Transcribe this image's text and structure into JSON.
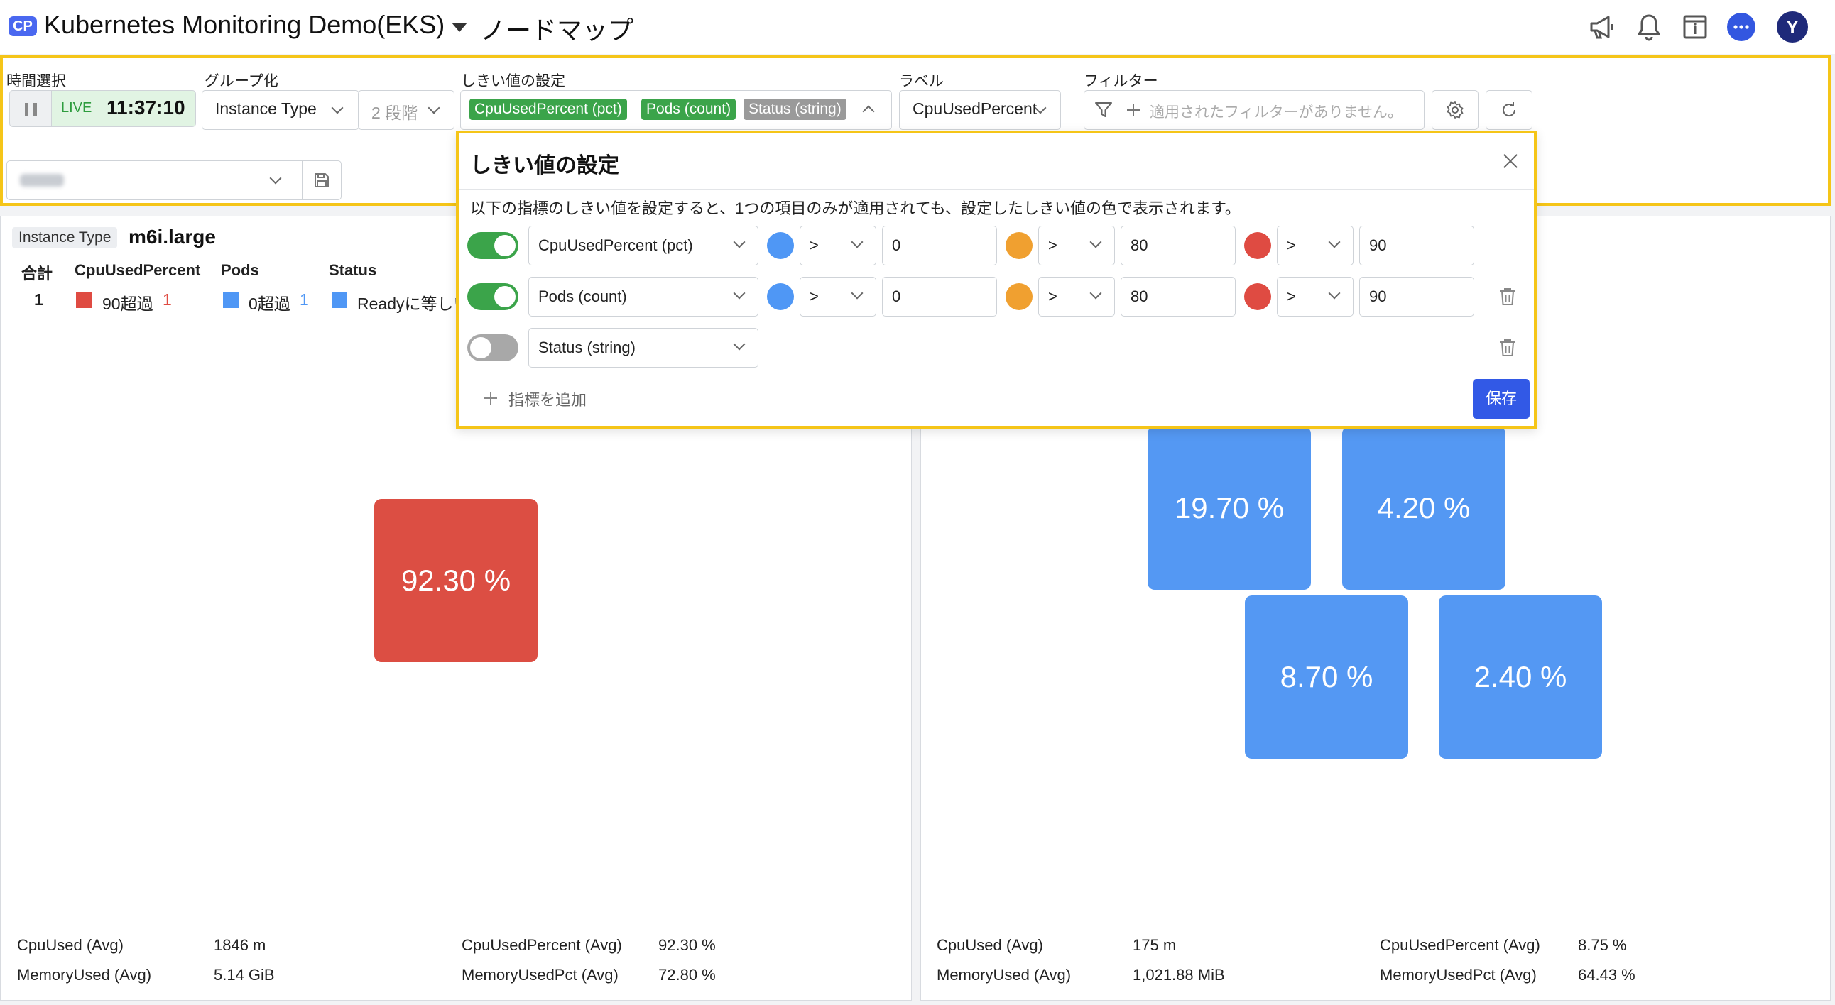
{
  "header": {
    "badge": "CP",
    "project": "Kubernetes Monitoring Demo(EKS)",
    "page_title": "ノードマップ"
  },
  "toolbar": {
    "time_label": "時間選択",
    "live_label": "LIVE",
    "live_time": "11:37:10",
    "group_label": "グループ化",
    "group_value": "Instance Type",
    "group_depth": "2 段階",
    "threshold_label": "しきい値の設定",
    "threshold_chips": [
      {
        "text": "CpuUsedPercent (pct)",
        "color": "#3ba44a"
      },
      {
        "text": "Pods (count)",
        "color": "#3ba44a"
      },
      {
        "text": "Status (string)",
        "color": "#9a9a9a"
      }
    ],
    "label_label": "ラベル",
    "label_value": "CpuUsedPercent",
    "filter_label": "フィルター",
    "filter_placeholder": "適用されたフィルターがありません。"
  },
  "popup": {
    "title": "しきい値の設定",
    "description": "以下の指標のしきい値を設定すると、1つの項目のみが適用されても、設定したしきい値の色で表示されます。",
    "rows": [
      {
        "enabled": true,
        "metric": "CpuUsedPercent (pct)",
        "op1": ">",
        "val1": "0",
        "op2": ">",
        "val2": "80",
        "op3": ">",
        "val3": "90"
      },
      {
        "enabled": true,
        "metric": "Pods (count)",
        "op1": ">",
        "val1": "0",
        "op2": ">",
        "val2": "80",
        "op3": ">",
        "val3": "90"
      },
      {
        "enabled": false,
        "metric": "Status (string)"
      }
    ],
    "add_metric": "指標を追加",
    "save": "保存"
  },
  "colors": {
    "blue": "#4f97f5",
    "orange": "#f0a030",
    "red": "#df4b42",
    "tile_red": "#dc4e43",
    "tile_blue": "#5498f3"
  },
  "left_panel": {
    "badge": "Instance Type",
    "group": "m6i.large",
    "legend_headers": {
      "total": "合計",
      "cpu": "CpuUsedPercent",
      "pods": "Pods",
      "status": "Status"
    },
    "legend_values": {
      "total": "1",
      "cpu_text": "90超過",
      "cpu_count": "1",
      "pods_text": "0超過",
      "pods_count": "1",
      "status_text": "Readyに等しい"
    },
    "tiles": [
      "92.30 %"
    ],
    "stats": {
      "cpu_used_label": "CpuUsed (Avg)",
      "cpu_used": "1846 m",
      "cpu_pct_label": "CpuUsedPercent (Avg)",
      "cpu_pct": "92.30 %",
      "mem_used_label": "MemoryUsed (Avg)",
      "mem_used": "5.14 GiB",
      "mem_pct_label": "MemoryUsedPct (Avg)",
      "mem_pct": "72.80 %"
    }
  },
  "right_panel": {
    "tiles": [
      "19.70 %",
      "4.20 %",
      "8.70 %",
      "2.40 %"
    ],
    "stats": {
      "cpu_used_label": "CpuUsed (Avg)",
      "cpu_used": "175 m",
      "cpu_pct_label": "CpuUsedPercent (Avg)",
      "cpu_pct": "8.75 %",
      "mem_used_label": "MemoryUsed (Avg)",
      "mem_used": "1,021.88 MiB",
      "mem_pct_label": "MemoryUsedPct (Avg)",
      "mem_pct": "64.43 %"
    }
  }
}
